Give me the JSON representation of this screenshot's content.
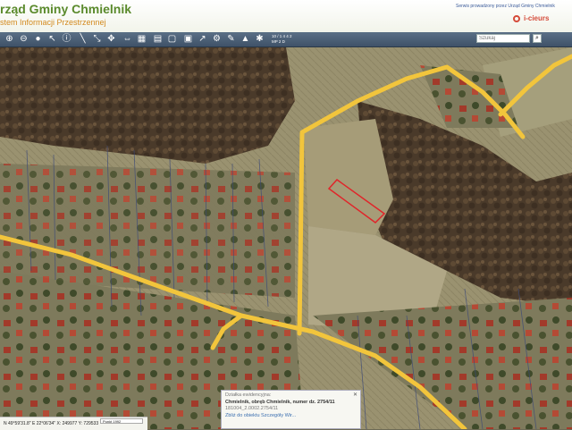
{
  "header": {
    "title": "rząd Gminy Chmielnik",
    "subtitle": "stem Informacji Przestrzennej",
    "top_note": "Serwis prowadzony przez Urząd Gminy Chmielnik",
    "logo_text": "i-cieurs"
  },
  "toolbar": {
    "scale_lines": "10 / 1 4 4 2\nMP 2 D",
    "search_placeholder": "Szukaj",
    "icons": [
      "zoom-in-icon",
      "zoom-out-icon",
      "full-extent-icon",
      "pan-icon",
      "select-icon",
      "info-icon",
      "measure-line-icon",
      "measure-area-icon",
      "back-icon",
      "forward-icon",
      "layers-icon",
      "legend-icon",
      "print-icon",
      "bookmark-icon",
      "annotation-icon",
      "coordinates-icon",
      "tools-icon"
    ]
  },
  "info_popup": {
    "heading": "Działka ewidencyjna:",
    "main": "Chmielnik, obręb Chmielnik, numer dz. 2754/11",
    "id_line": "181004_2.0002.2754/11",
    "links": "Zbliż do obiektu   Szczegóły   Wir..."
  },
  "coords_bar": {
    "text": "N 49°59'31.8\" E 22°06'34\"   X: 249977  Y: 729533",
    "select_value": "Punkt 1992"
  },
  "colors": {
    "road": "#f2c53c",
    "parcel": "#e0252a",
    "toolbar": "#4c6078",
    "title": "#5a8a2c"
  }
}
